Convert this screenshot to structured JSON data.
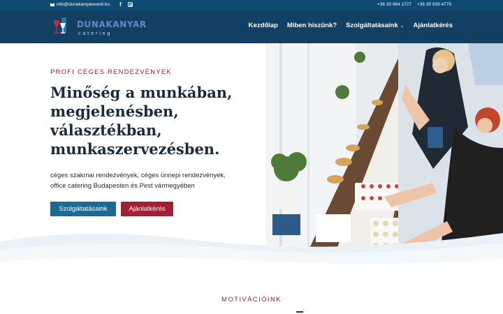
{
  "topbar": {
    "email": "info@dunakanyarevent.hu",
    "phone1": "+36 30 964 1727",
    "phone2": "+36 30 939 4779",
    "icons": [
      "mail-icon",
      "facebook-icon",
      "instagram-icon"
    ]
  },
  "header": {
    "logo_name": "DUNAKANYAR",
    "logo_sub": "catering",
    "nav": [
      {
        "label": "Kezdőlap"
      },
      {
        "label": "Miben hiszünk?"
      },
      {
        "label": "Szolgáltatásaink"
      },
      {
        "label": "Ajánlatkérés"
      }
    ]
  },
  "hero": {
    "eyebrow": "PROFI CÉGES RENDEZVÉNYEK",
    "headline": [
      "Minőség a munkában,",
      "megjelenésben,",
      "választékban,",
      "munkaszervezésben."
    ],
    "description": [
      "céges szakmai rendezvények, céges ünnepi rendezvények,",
      "office catering Budapesten és Pest vármegyében"
    ],
    "buttons": {
      "primary": "Szolgáltatásaink",
      "secondary": "Ajánlatkérés"
    }
  },
  "section": {
    "label": "MOTIVÁCIÓINK"
  },
  "colors": {
    "topbar_bg": "#0f4a73",
    "header_bg": "#123f62",
    "accent_red": "#a31f34",
    "accent_blue": "#1d6a94",
    "heading": "#1c2b39"
  }
}
